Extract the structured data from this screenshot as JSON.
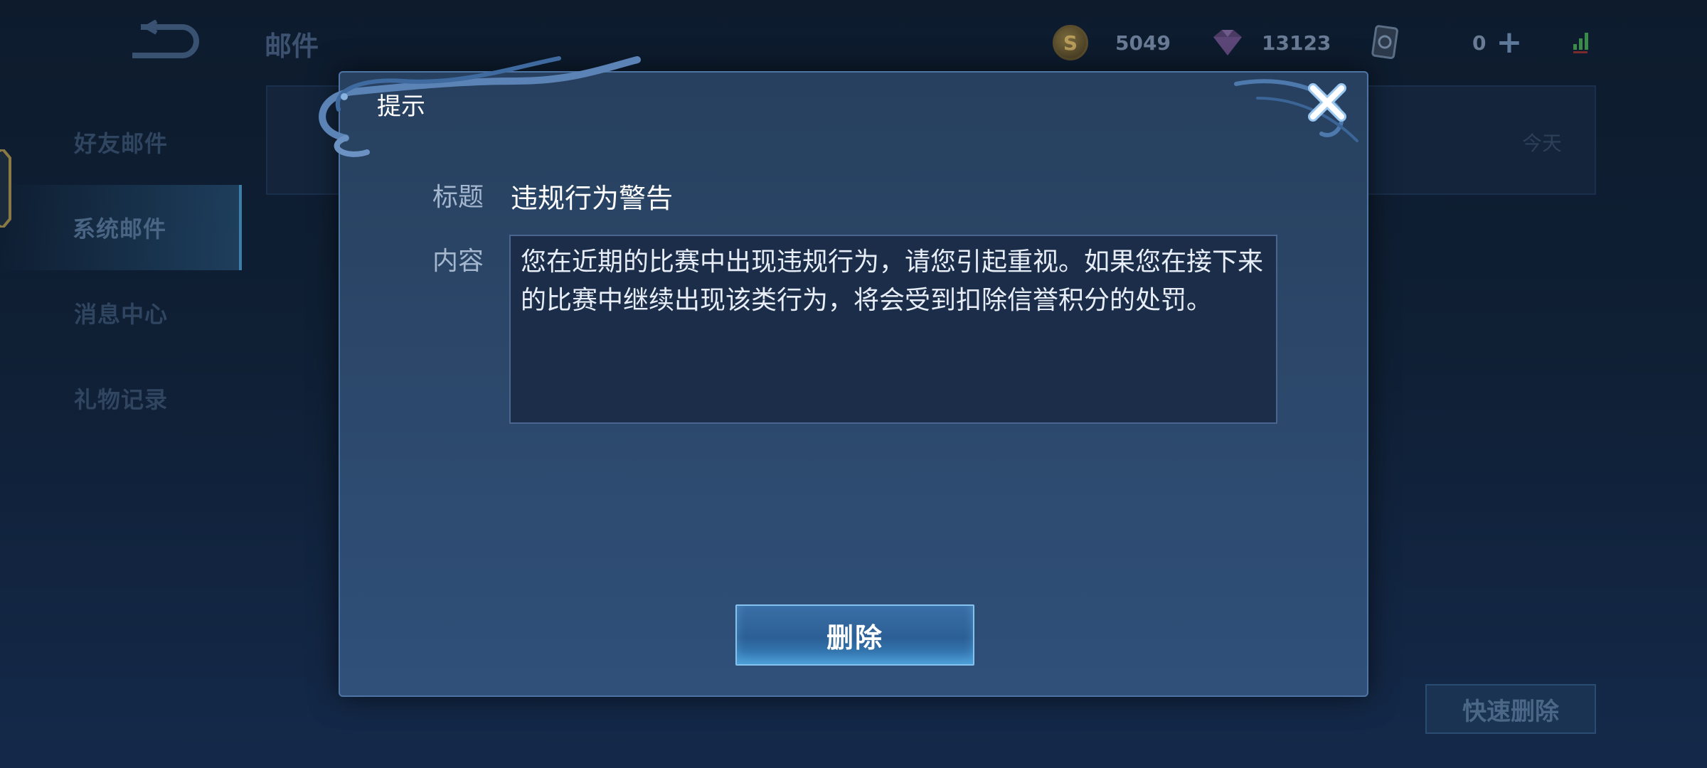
{
  "header": {
    "title": "邮件",
    "resources": {
      "gold": "5049",
      "gems": "13123",
      "cards": "0"
    },
    "icons": [
      "back-arrow-icon",
      "gold-coin-icon",
      "gem-icon",
      "card-icon",
      "add-icon",
      "signal-icon"
    ]
  },
  "sidebar": {
    "items": [
      {
        "label": "好友邮件"
      },
      {
        "label": "系统邮件",
        "active": true
      },
      {
        "label": "消息中心"
      },
      {
        "label": "礼物记录"
      }
    ]
  },
  "mail_list": {
    "date": "今天"
  },
  "footer": {
    "quick_delete_label": "快速删除"
  },
  "dialog": {
    "title": "提示",
    "title_label": "标题",
    "title_value": "违规行为警告",
    "content_label": "内容",
    "content_value": "您在近期的比赛中出现违规行为，请您引起重视。如果您在接下来的比赛中继续出现该类行为，将会受到扣除信誉积分的处罚。",
    "delete_label": "删除"
  },
  "colors": {
    "accent": "#3b89c6",
    "dialog_bg": "#2b4668",
    "dialog_border": "#4d74a3"
  }
}
